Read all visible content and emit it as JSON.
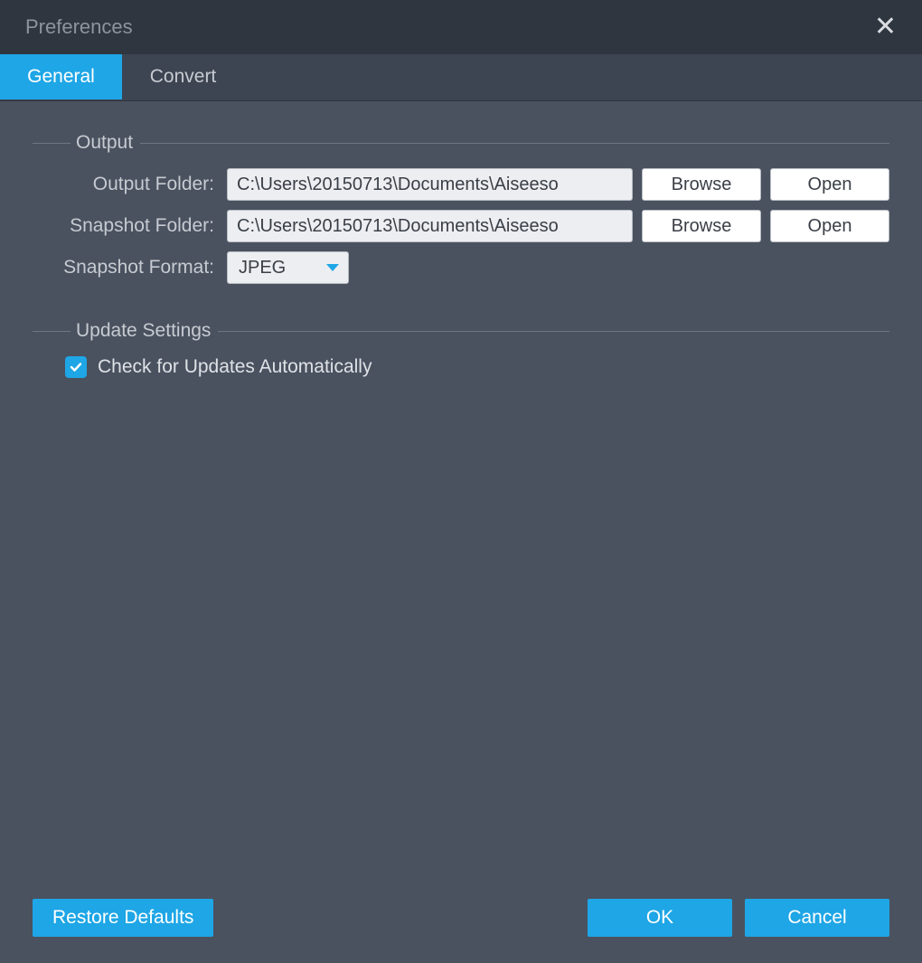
{
  "window": {
    "title": "Preferences"
  },
  "tabs": {
    "general": "General",
    "convert": "Convert"
  },
  "sections": {
    "output": {
      "title": "Output",
      "output_folder_label": "Output Folder:",
      "output_folder_value": "C:\\Users\\20150713\\Documents\\Aiseeso",
      "snapshot_folder_label": "Snapshot Folder:",
      "snapshot_folder_value": "C:\\Users\\20150713\\Documents\\Aiseeso",
      "snapshot_format_label": "Snapshot Format:",
      "snapshot_format_value": "JPEG",
      "browse_label": "Browse",
      "open_label": "Open"
    },
    "update": {
      "title": "Update Settings",
      "check_updates_label": "Check for Updates Automatically",
      "check_updates_checked": true
    }
  },
  "footer": {
    "restore": "Restore Defaults",
    "ok": "OK",
    "cancel": "Cancel"
  }
}
